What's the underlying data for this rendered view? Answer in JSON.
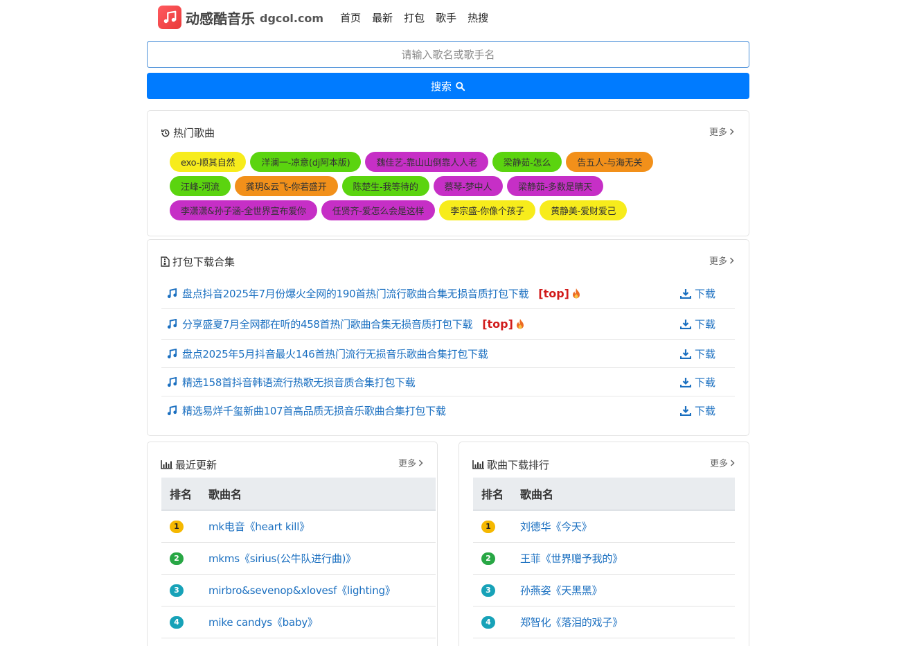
{
  "site": {
    "name": "动感酷音乐",
    "domain": "dgcol.com"
  },
  "nav": [
    "首页",
    "最新",
    "打包",
    "歌手",
    "热搜"
  ],
  "search": {
    "placeholder": "请输入歌名或歌手名",
    "button_label": "搜索"
  },
  "colors": {
    "primary": "#007bff",
    "link": "#1a6fc0",
    "top_red": "#d11a1a",
    "yellow": "#f7ec1c",
    "green": "#5bd40f",
    "magenta": "#c62fc6",
    "orange": "#f2901a"
  },
  "hot_songs": {
    "title": "热门歌曲",
    "more": "更多",
    "tags": [
      {
        "label": "exo-顺其自然",
        "color": "#f7ec1c"
      },
      {
        "label": "洋澜一-凉意(dj阿本版)",
        "color": "#5bd40f"
      },
      {
        "label": "魏佳艺-靠山山倒靠人人老",
        "color": "#c62fc6"
      },
      {
        "label": "梁静茹-怎么",
        "color": "#5bd40f"
      },
      {
        "label": "告五人-与海无关",
        "color": "#f2901a"
      },
      {
        "label": "汪峰-河流",
        "color": "#5bd40f"
      },
      {
        "label": "龚玥&云飞-你若盛开",
        "color": "#f2901a"
      },
      {
        "label": "陈楚生-我等待的",
        "color": "#5bd40f"
      },
      {
        "label": "蔡琴-梦中人",
        "color": "#c62fc6"
      },
      {
        "label": "梁静茹-多数是晴天",
        "color": "#c62fc6"
      },
      {
        "label": "李潇潇&孙子涵-全世界宣布爱你",
        "color": "#c62fc6"
      },
      {
        "label": "任贤齐-爱怎么会是这样",
        "color": "#c62fc6"
      },
      {
        "label": "李宗盛-你像个孩子",
        "color": "#f7ec1c"
      },
      {
        "label": "黄静美-爱财爱己",
        "color": "#f7ec1c"
      }
    ]
  },
  "packs": {
    "title": "打包下载合集",
    "more": "更多",
    "download_label": "下载",
    "top_label": "[top]",
    "items": [
      {
        "title": "盘点抖音2025年7月份爆火全网的190首热门流行歌曲合集无损音质打包下载",
        "top": true
      },
      {
        "title": "分享盛夏7月全网都在听的458首热门歌曲合集无损音质打包下载",
        "top": true
      },
      {
        "title": "盘点2025年5月抖音最火146首热门流行无损音乐歌曲合集打包下载",
        "top": false
      },
      {
        "title": "精选158首抖音韩语流行热歌无损音质合集打包下载",
        "top": false
      },
      {
        "title": "精选易烊千玺新曲107首高品质无损音乐歌曲合集打包下载",
        "top": false
      }
    ]
  },
  "recent": {
    "title": "最近更新",
    "more": "更多",
    "col_rank": "排名",
    "col_song": "歌曲名",
    "rows": [
      {
        "rank": "1",
        "song": "mk电音《heart kill》"
      },
      {
        "rank": "2",
        "song": "mkms《sirius(公牛队进行曲)》"
      },
      {
        "rank": "3",
        "song": "mirbro&sevenop&xlovesf《lighting》"
      },
      {
        "rank": "4",
        "song": "mike candys《baby》"
      }
    ]
  },
  "ranking": {
    "title": "歌曲下载排行",
    "more": "更多",
    "col_rank": "排名",
    "col_song": "歌曲名",
    "rows": [
      {
        "rank": "1",
        "song": "刘德华《今天》"
      },
      {
        "rank": "2",
        "song": "王菲《世界赠予我的》"
      },
      {
        "rank": "3",
        "song": "孙燕姿《天黑黑》"
      },
      {
        "rank": "4",
        "song": "郑智化《落泪的戏子》"
      }
    ]
  }
}
